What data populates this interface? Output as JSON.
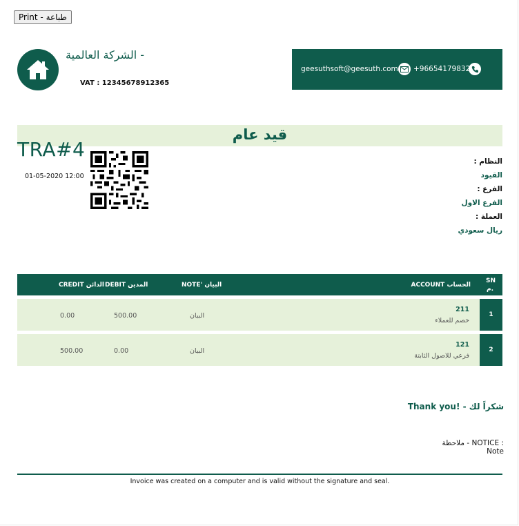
{
  "print_button": "Print - طباعة",
  "company": {
    "name": "- الشركة العالمية",
    "vat": "VAT : 12345678912365",
    "email": "geesuthsoft@geesuth.com",
    "phone": "+966541798323"
  },
  "document": {
    "title": "قيد عام",
    "number": "TRA#4",
    "date": "01-05-2020 12:00"
  },
  "meta": {
    "system_label": "النظام :",
    "system_value": "القيود",
    "branch_label": "الفرع :",
    "branch_value": "الفرع الاول",
    "currency_label": "العملة :",
    "currency_value": "ريال سعودي"
  },
  "table": {
    "headers": {
      "sn": "SN",
      "sn_ar": "م.",
      "account": "ACCOUNT الحساب",
      "note": "NOTE' البيان",
      "debit": "DEBIT المدين",
      "credit": "CREDIT الدائن"
    },
    "rows": [
      {
        "sn": "1",
        "code": "211",
        "name": "خصم للعملاء",
        "note": "البيان",
        "debit": "500.00",
        "credit": "0.00"
      },
      {
        "sn": "2",
        "code": "121",
        "name": "فرعي للاصول الثابتة",
        "note": "البيان",
        "debit": "0.00",
        "credit": "500.00"
      }
    ]
  },
  "thanks": "Thank you! - شكراً لك",
  "notice_label": "ملاحظة - NOTICE :",
  "notice_text": "Note",
  "footer": "Invoice was created on a computer and is valid without the signature and seal.",
  "colors": {
    "primary": "#0f5c4c",
    "light": "#e6f1da"
  },
  "icons": [
    "home-icon",
    "mail-icon",
    "phone-icon",
    "qr-code"
  ]
}
